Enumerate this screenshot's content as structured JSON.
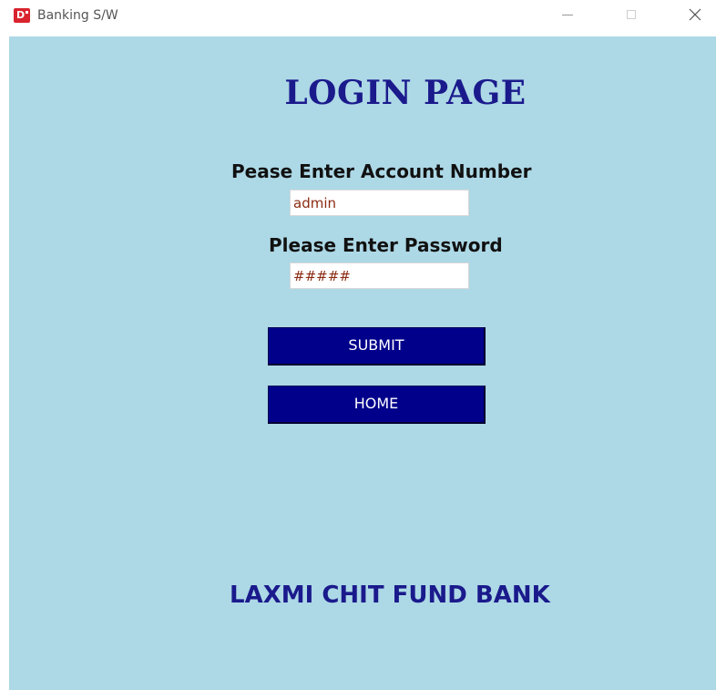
{
  "window": {
    "title": "Banking S/W",
    "icon": "app-logo-icon",
    "controls": {
      "minimize": "minimize-icon",
      "maximize": "maximize-icon",
      "close_glyph": "✕"
    }
  },
  "form": {
    "heading": "LOGIN PAGE",
    "account_label": "Pease Enter Account Number",
    "account_value": "admin",
    "password_label": "Please Enter Password",
    "password_value": "#####",
    "submit_label": "SUBMIT",
    "home_label": "HOME"
  },
  "footer": {
    "bank_name": "LAXMI CHIT FUND BANK"
  },
  "colors": {
    "background": "#add8e6",
    "heading": "#1a1a8c",
    "button": "#00008b",
    "input_text": "#8b2b12",
    "app_icon": "#d9232e"
  }
}
